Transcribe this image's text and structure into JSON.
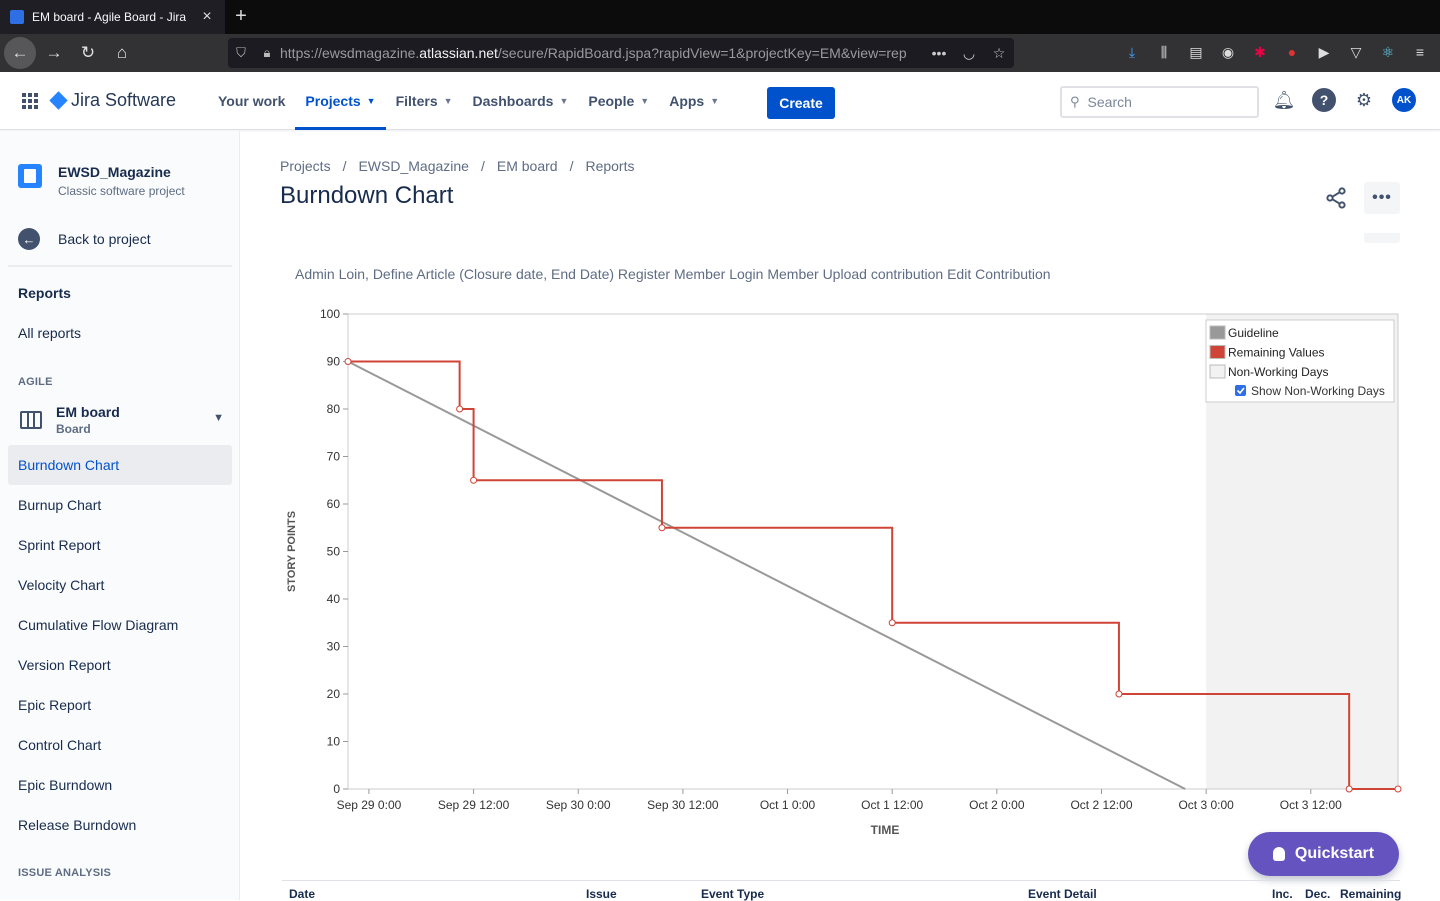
{
  "browser": {
    "tab_title": "EM board - Agile Board - Jira",
    "url_prefix": "https://ewsdmagazine.",
    "url_domain": "atlassian.net",
    "url_path": "/secure/RapidBoard.jspa?rapidView=1&projectKey=EM&view=rep"
  },
  "topnav": {
    "product": "Jira Software",
    "items": [
      "Your work",
      "Projects",
      "Filters",
      "Dashboards",
      "People",
      "Apps"
    ],
    "create": "Create",
    "search_placeholder": "Search",
    "avatar": "AK"
  },
  "sidebar": {
    "project_name": "EWSD_Magazine",
    "project_type": "Classic software project",
    "back": "Back to project",
    "reports_heading": "Reports",
    "all_reports": "All reports",
    "agile_caption": "AGILE",
    "board_name": "EM board",
    "board_sub": "Board",
    "reports": [
      "Burndown Chart",
      "Burnup Chart",
      "Sprint Report",
      "Velocity Chart",
      "Cumulative Flow Diagram",
      "Version Report",
      "Epic Report",
      "Control Chart",
      "Epic Burndown",
      "Release Burndown"
    ],
    "selected": "Burndown Chart",
    "issue_analysis_caption": "ISSUE ANALYSIS"
  },
  "main": {
    "breadcrumbs": [
      "Projects",
      "EWSD_Magazine",
      "EM board",
      "Reports"
    ],
    "title": "Burndown Chart",
    "sprint_goal": "Admin Loin, Define Article (Closure date, End Date) Register Member Login Member Upload contribution Edit Contribution",
    "quickstart": "Quickstart",
    "table_headers": [
      "Date",
      "Issue",
      "Event Type",
      "Event Detail",
      "Inc.",
      "Dec.",
      "Remaining"
    ]
  },
  "chart_data": {
    "type": "line",
    "xlabel": "TIME",
    "ylabel": "STORY POINTS",
    "ylim": [
      0,
      100
    ],
    "y_ticks": [
      0,
      10,
      20,
      30,
      40,
      50,
      60,
      70,
      80,
      90,
      100
    ],
    "x_tick_labels": [
      "Sep 29 0:00",
      "Sep 29 12:00",
      "Sep 30 0:00",
      "Sep 30 12:00",
      "Oct 1 0:00",
      "Oct 1 12:00",
      "Oct 2 0:00",
      "Oct 2 12:00",
      "Oct 3 0:00",
      "Oct 3 12:00"
    ],
    "x_tick_hours": [
      0,
      12,
      24,
      36,
      48,
      60,
      72,
      84,
      96,
      108
    ],
    "xlim_hours": [
      -2.4,
      118
    ],
    "x_unit_note": "hours after Sep 29 0:00",
    "non_working_start_hours": 96,
    "legend": [
      "Guideline",
      "Remaining Values",
      "Non-Working Days"
    ],
    "legend_checkbox": "Show Non-Working Days",
    "legend_position": "top-right",
    "colors": {
      "guideline": "#999999",
      "remaining": "#d04437",
      "non_working": "#f2f2f2"
    },
    "series": [
      {
        "name": "Guideline",
        "x": [
          -2.4,
          93.6
        ],
        "y": [
          90,
          0
        ]
      },
      {
        "name": "Remaining Values",
        "step": true,
        "x": [
          -2.4,
          10.4,
          12.0,
          33.6,
          60.0,
          86.0,
          112.4,
          118.0
        ],
        "y": [
          90,
          80,
          65,
          55,
          35,
          20,
          0,
          0
        ]
      }
    ]
  }
}
